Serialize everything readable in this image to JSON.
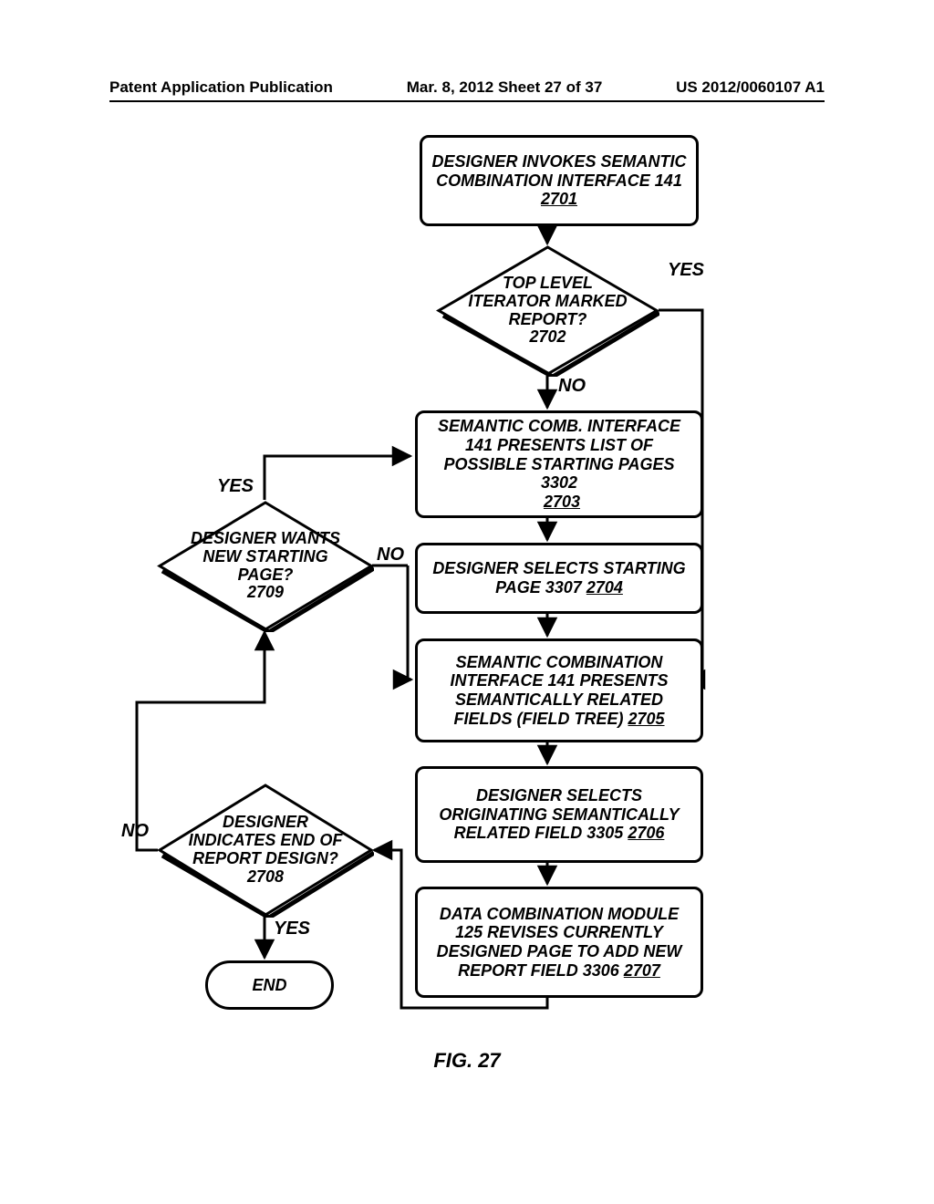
{
  "header": {
    "left": "Patent Application Publication",
    "mid": "Mar. 8, 2012  Sheet 27 of 37",
    "right": "US 2012/0060107 A1"
  },
  "caption": "FIG. 27",
  "labels": {
    "yes": "YES",
    "no": "NO"
  },
  "steps": {
    "s2701": {
      "text": "DESIGNER INVOKES SEMANTIC COMBINATION INTERFACE 141",
      "ref": "2701"
    },
    "s2702": {
      "text": "TOP LEVEL ITERATOR MARKED REPORT?",
      "ref": "2702"
    },
    "s2703": {
      "text": "SEMANTIC COMB. INTERFACE 141 PRESENTS LIST OF POSSIBLE STARTING PAGES 3302",
      "ref": "2703"
    },
    "s2704": {
      "text": "DESIGNER SELECTS STARTING PAGE 3307",
      "ref": "2704"
    },
    "s2705": {
      "text": "SEMANTIC COMBINATION INTERFACE 141 PRESENTS SEMANTICALLY RELATED FIELDS (FIELD TREE)",
      "ref": "2705"
    },
    "s2706": {
      "text": "DESIGNER SELECTS ORIGINATING SEMANTICALLY RELATED FIELD 3305",
      "ref": "2706"
    },
    "s2707": {
      "text": "DATA COMBINATION MODULE 125 REVISES CURRENTLY DESIGNED PAGE TO ADD NEW REPORT FIELD 3306",
      "ref": "2707"
    },
    "s2708": {
      "text": "DESIGNER INDICATES END OF REPORT DESIGN?",
      "ref": "2708"
    },
    "s2709": {
      "text": "DESIGNER WANTS NEW STARTING PAGE?",
      "ref": "2709"
    },
    "end": {
      "text": "END"
    }
  }
}
